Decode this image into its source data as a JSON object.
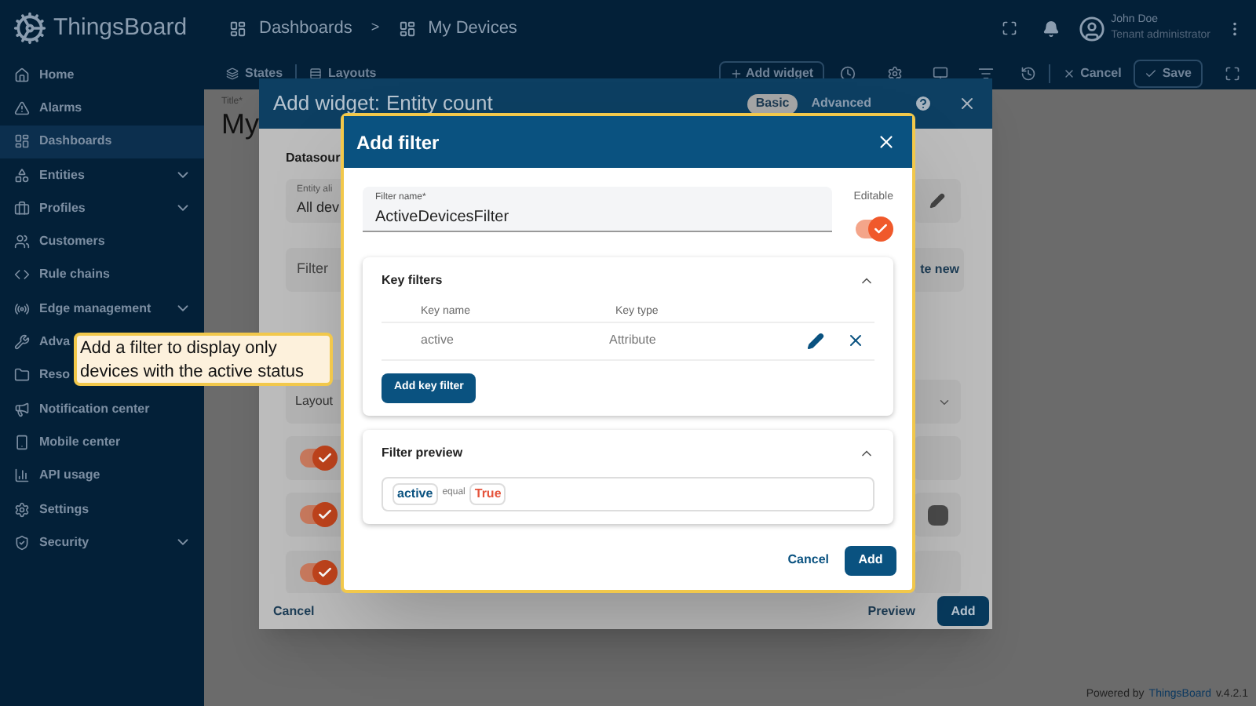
{
  "app": {
    "name": "ThingsBoard"
  },
  "breadcrumbs": {
    "separator": ">",
    "items": [
      {
        "label": "Dashboards"
      },
      {
        "label": "My Devices"
      }
    ]
  },
  "user": {
    "name": "John Doe",
    "role": "Tenant administrator"
  },
  "sidebar": {
    "items": [
      {
        "label": "Home",
        "selected": false,
        "submenu": false
      },
      {
        "label": "Alarms",
        "selected": false,
        "submenu": false
      },
      {
        "label": "Dashboards",
        "selected": true,
        "submenu": false
      },
      {
        "label": "Entities",
        "selected": false,
        "submenu": true
      },
      {
        "label": "Profiles",
        "selected": false,
        "submenu": true
      },
      {
        "label": "Customers",
        "selected": false,
        "submenu": false
      },
      {
        "label": "Rule chains",
        "selected": false,
        "submenu": false
      },
      {
        "label": "Edge management",
        "selected": false,
        "submenu": true
      },
      {
        "label": "Adva",
        "selected": false
      },
      {
        "label": "Reso",
        "selected": false
      },
      {
        "label": "Notification center",
        "selected": false,
        "submenu": false
      },
      {
        "label": "Mobile center",
        "selected": false,
        "submenu": false
      },
      {
        "label": "API usage",
        "selected": false,
        "submenu": false
      },
      {
        "label": "Settings",
        "selected": false,
        "submenu": false
      },
      {
        "label": "Security",
        "selected": false,
        "submenu": true
      }
    ]
  },
  "toolbar": {
    "states": "States",
    "layouts": "Layouts",
    "add_widget": "Add widget",
    "cancel": "Cancel",
    "save": "Save"
  },
  "dashboard": {
    "title_label": "Title*",
    "title": "My"
  },
  "widget_dialog": {
    "title": "Add widget:",
    "subtitle": "Entity count",
    "modes": [
      {
        "label": "Basic",
        "selected": true
      },
      {
        "label": "Advanced",
        "selected": false
      }
    ],
    "section": "Datasour",
    "alias_label": "Entity ali",
    "alias_value": "All dev",
    "filter": "Filter",
    "create_new": "te new",
    "layout": "Layout",
    "toggles": [
      {
        "on": true
      },
      {
        "on": true
      },
      {
        "on": true
      }
    ],
    "cancel": "Cancel",
    "preview": "Preview",
    "add": "Add"
  },
  "filter_dialog": {
    "title": "Add filter",
    "name_label": "Filter name*",
    "name_value": "ActiveDevicesFilter",
    "editable_label": "Editable",
    "editable": true,
    "key_filters": {
      "title": "Key filters",
      "expanded": true,
      "columns": [
        "Key name",
        "Key type"
      ],
      "rows": [
        {
          "key_name": "active",
          "key_type": "Attribute"
        }
      ],
      "add_button": "Add key filter"
    },
    "preview": {
      "title": "Filter preview",
      "expanded": true,
      "key": "active",
      "operation": "equal",
      "value": "True"
    },
    "cancel": "Cancel",
    "add": "Add"
  },
  "tooltip": "Add a filter to display only devices with the active status",
  "footer": {
    "prefix": "Powered by",
    "brand": "ThingsBoard",
    "version": "v.4.2.1"
  }
}
